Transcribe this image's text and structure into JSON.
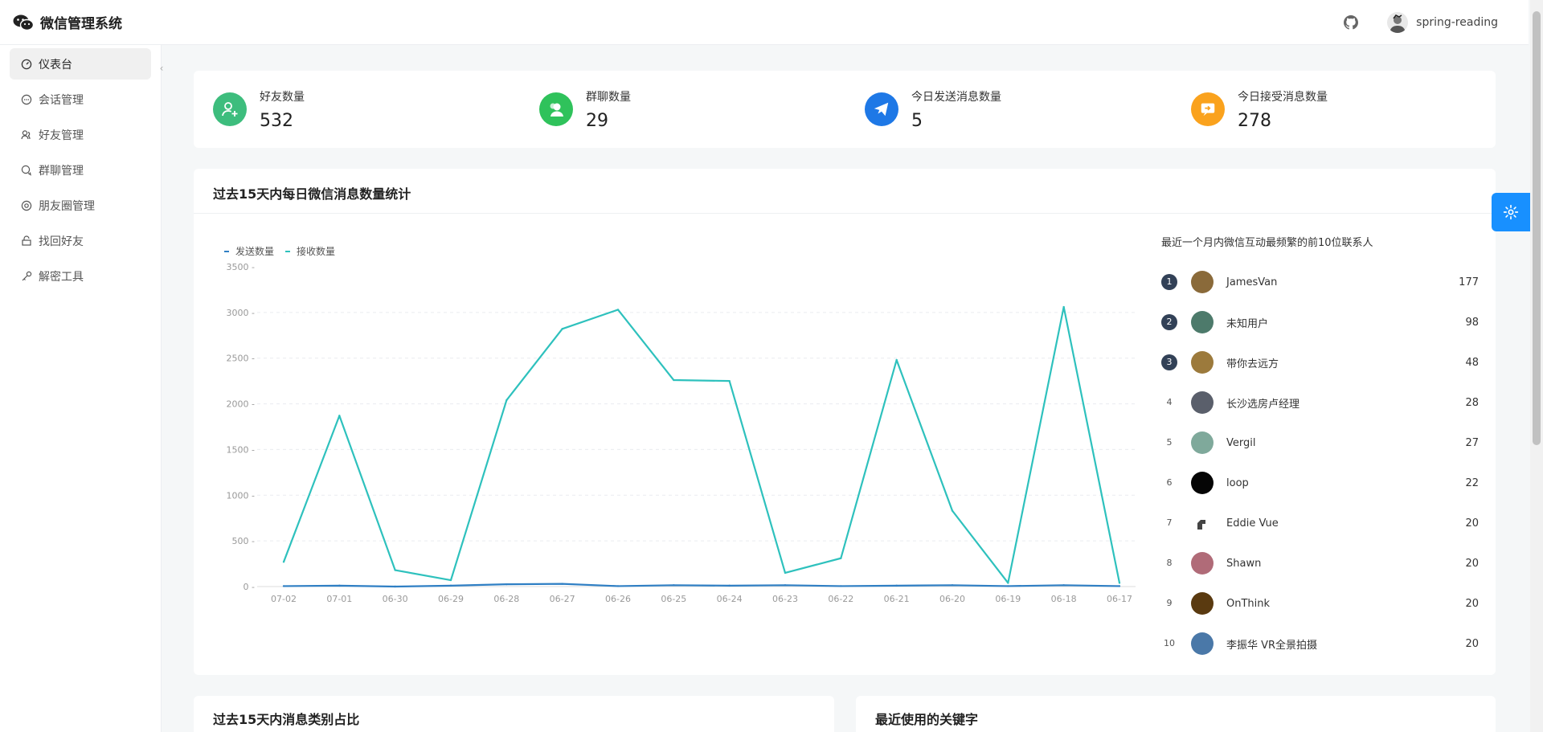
{
  "header": {
    "title": "微信管理系统",
    "username": "spring-reading"
  },
  "sidebar": {
    "items": [
      {
        "label": "仪表台",
        "icon": "dashboard-icon",
        "active": true
      },
      {
        "label": "会话管理",
        "icon": "chat-icon"
      },
      {
        "label": "好友管理",
        "icon": "contacts-icon"
      },
      {
        "label": "群聊管理",
        "icon": "group-chat-icon"
      },
      {
        "label": "朋友圈管理",
        "icon": "moments-icon"
      },
      {
        "label": "找回好友",
        "icon": "recover-icon"
      },
      {
        "label": "解密工具",
        "icon": "key-icon"
      }
    ]
  },
  "stats": [
    {
      "label": "好友数量",
      "value": "532",
      "color": "#3dbd7d",
      "icon": "add-friend-icon"
    },
    {
      "label": "群聊数量",
      "value": "29",
      "color": "#2fc25b",
      "icon": "group-icon"
    },
    {
      "label": "今日发送消息数量",
      "value": "5",
      "color": "#1e78e6",
      "icon": "send-icon"
    },
    {
      "label": "今日接受消息数量",
      "value": "278",
      "color": "#faa21d",
      "icon": "receive-message-icon"
    }
  ],
  "chart_card": {
    "title": "过去15天内每日微信消息数量统计"
  },
  "chart_data": {
    "type": "line",
    "categories": [
      "07-02",
      "07-01",
      "06-30",
      "06-29",
      "06-28",
      "06-27",
      "06-26",
      "06-25",
      "06-24",
      "06-23",
      "06-22",
      "06-21",
      "06-20",
      "06-19",
      "06-18",
      "06-17"
    ],
    "series": [
      {
        "name": "发送数量",
        "color": "#2f7fc4",
        "values": [
          5,
          10,
          0,
          10,
          25,
          30,
          5,
          15,
          10,
          15,
          5,
          10,
          15,
          5,
          15,
          5
        ]
      },
      {
        "name": "接收数量",
        "color": "#2ec1bd",
        "values": [
          270,
          1870,
          180,
          70,
          2040,
          2820,
          3030,
          2260,
          2250,
          150,
          310,
          2480,
          830,
          40,
          3060,
          40
        ]
      }
    ],
    "yticks": [
      0,
      500,
      1000,
      1500,
      2000,
      2500,
      3000,
      3500
    ],
    "ylim": [
      0,
      3500
    ],
    "grid": true,
    "legend": "top-left"
  },
  "ranking": {
    "title": "最近一个月内微信互动最频繁的前10位联系人",
    "items": [
      {
        "rank": "1",
        "name": "JamesVan",
        "count": "177",
        "avatar_color": "#8a6a3a"
      },
      {
        "rank": "2",
        "name": "未知用户",
        "count": "98",
        "avatar_color": "#4d7a6b"
      },
      {
        "rank": "3",
        "name": "带你去远方",
        "count": "48",
        "avatar_color": "#9c7a3c"
      },
      {
        "rank": "4",
        "name": "长沙选房卢经理",
        "count": "28",
        "avatar_color": "#5a5f6b"
      },
      {
        "rank": "5",
        "name": "Vergil",
        "count": "27",
        "avatar_color": "#7fa99b"
      },
      {
        "rank": "6",
        "name": "loop",
        "count": "22",
        "avatar_color": "#050505"
      },
      {
        "rank": "7",
        "name": "Eddie Vue",
        "count": "20",
        "avatar_color": "#ffffff"
      },
      {
        "rank": "8",
        "name": "Shawn",
        "count": "20",
        "avatar_color": "#b06b78"
      },
      {
        "rank": "9",
        "name": "OnThink",
        "count": "20",
        "avatar_color": "#5a3a10"
      },
      {
        "rank": "10",
        "name": "李振华 VR全景拍摄",
        "count": "20",
        "avatar_color": "#4a78a8"
      }
    ]
  },
  "bottom_cards": [
    {
      "title": "过去15天内消息类别占比"
    },
    {
      "title": "最近使用的关键字"
    }
  ]
}
